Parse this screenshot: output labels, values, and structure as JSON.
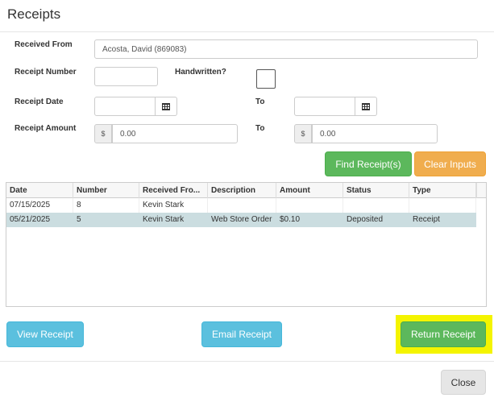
{
  "modal": {
    "title": "Receipts",
    "close_label": "Close"
  },
  "form": {
    "received_from": {
      "label": "Received From",
      "value": "Acosta, David (869083)"
    },
    "receipt_number": {
      "label": "Receipt Number",
      "value": ""
    },
    "handwritten": {
      "label": "Handwritten?",
      "checked": false
    },
    "receipt_date": {
      "label": "Receipt Date",
      "from": "",
      "to_label": "To",
      "to": ""
    },
    "receipt_amount": {
      "label": "Receipt Amount",
      "currency": "$",
      "from": "0.00",
      "to_label": "To",
      "to": "0.00"
    },
    "find_label": "Find Receipt(s)",
    "clear_label": "Clear Inputs"
  },
  "table": {
    "columns": [
      "Date",
      "Number",
      "Received Fro...",
      "Description",
      "Amount",
      "Status",
      "Type"
    ],
    "rows": [
      {
        "date": "07/15/2025",
        "number": "8",
        "received_from": "Kevin Stark",
        "description": "",
        "amount": "",
        "status": "",
        "type": "",
        "selected": false
      },
      {
        "date": "05/21/2025",
        "number": "5",
        "received_from": "Kevin Stark",
        "description": "Web Store Order",
        "amount": "$0.10",
        "status": "Deposited",
        "type": "Receipt",
        "selected": true
      }
    ]
  },
  "actions": {
    "view_label": "View Receipt",
    "email_label": "Email Receipt",
    "return_label": "Return Receipt"
  },
  "colors": {
    "green": "#5cb85c",
    "orange": "#f0ad4e",
    "info": "#5bc0de",
    "highlight": "#f4f400",
    "selected_row": "#cbdde0"
  }
}
